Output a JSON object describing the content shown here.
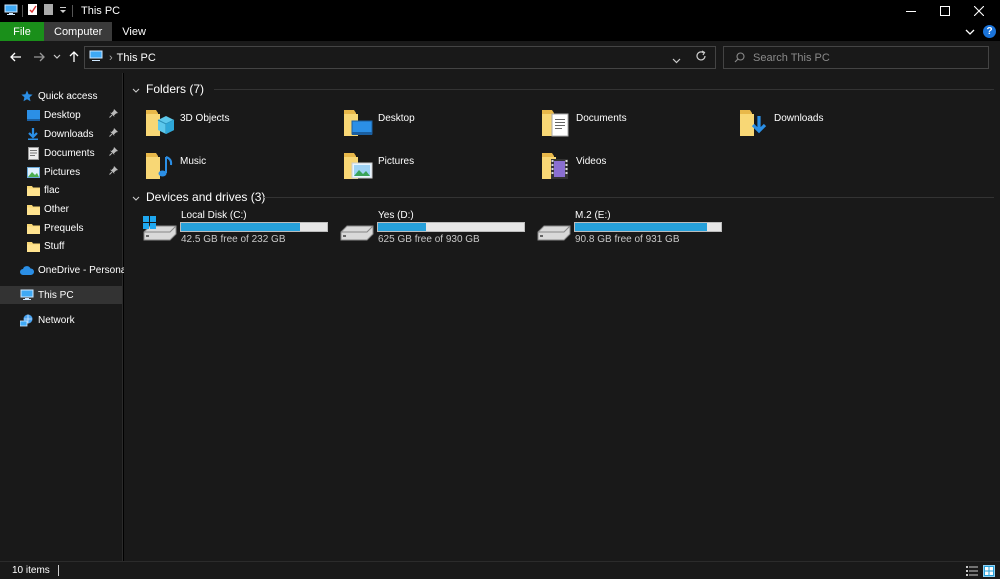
{
  "window": {
    "title": "This PC"
  },
  "ribbon": {
    "tabs": [
      {
        "label": "File"
      },
      {
        "label": "Computer"
      },
      {
        "label": "View"
      }
    ],
    "help_label": "?"
  },
  "address": {
    "crumb": "This PC",
    "search_placeholder": "Search This PC"
  },
  "sidebar": {
    "quick_access": "Quick access",
    "items": [
      {
        "label": "Desktop",
        "icon": "desktop-icon",
        "pinned": true
      },
      {
        "label": "Downloads",
        "icon": "downloads-icon",
        "pinned": true
      },
      {
        "label": "Documents",
        "icon": "documents-icon",
        "pinned": true
      },
      {
        "label": "Pictures",
        "icon": "pictures-icon",
        "pinned": true
      },
      {
        "label": "flac",
        "icon": "folder-icon",
        "pinned": false
      },
      {
        "label": "Other",
        "icon": "folder-icon",
        "pinned": false
      },
      {
        "label": "Prequels",
        "icon": "folder-icon",
        "pinned": false
      },
      {
        "label": "Stuff",
        "icon": "folder-icon",
        "pinned": false
      }
    ],
    "onedrive": "OneDrive - Personal",
    "this_pc": "This PC",
    "network": "Network"
  },
  "folders": {
    "header": "Folders (7)",
    "items": [
      {
        "label": "3D Objects",
        "icon": "3d-objects-icon"
      },
      {
        "label": "Desktop",
        "icon": "desktop-folder-icon"
      },
      {
        "label": "Documents",
        "icon": "documents-folder-icon"
      },
      {
        "label": "Downloads",
        "icon": "downloads-folder-icon"
      },
      {
        "label": "Music",
        "icon": "music-folder-icon"
      },
      {
        "label": "Pictures",
        "icon": "pictures-folder-icon"
      },
      {
        "label": "Videos",
        "icon": "videos-folder-icon"
      }
    ]
  },
  "drives": {
    "header": "Devices and drives (3)",
    "items": [
      {
        "label": "Local Disk (C:)",
        "free": "42.5 GB free of 232 GB",
        "used_fraction": 0.817,
        "icon": "windows-drive-icon"
      },
      {
        "label": "Yes (D:)",
        "free": "625 GB free of 930 GB",
        "used_fraction": 0.328,
        "icon": "hard-drive-icon"
      },
      {
        "label": "M.2 (E:)",
        "free": "90.8 GB free of 931 GB",
        "used_fraction": 0.902,
        "icon": "hard-drive-icon"
      }
    ]
  },
  "status": {
    "items_count": "10 items"
  },
  "colors": {
    "file_tab": "#1a8f1a",
    "progress": "#26a0da",
    "folder_yellow": "#f8d775",
    "accent_blue": "#1a73d9"
  }
}
